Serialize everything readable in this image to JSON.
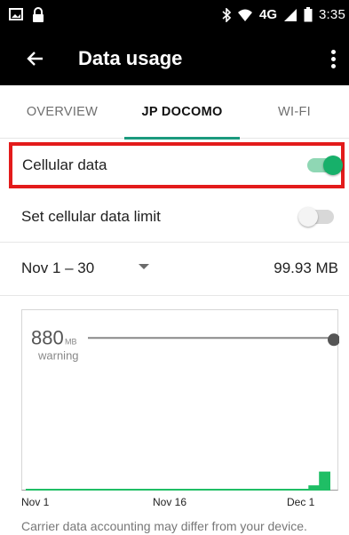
{
  "status_bar": {
    "time": "3:35",
    "network": "4G",
    "icons": [
      "image-icon",
      "lock-icon",
      "bluetooth-icon",
      "wifi-icon",
      "signal-icon",
      "battery-icon"
    ]
  },
  "app_bar": {
    "title": "Data usage",
    "back_icon": "arrow-back-icon",
    "menu_icon": "overflow-menu-icon"
  },
  "tabs": [
    {
      "label": "OVERVIEW",
      "selected": false
    },
    {
      "label": "JP DOCOMO",
      "selected": true
    },
    {
      "label": "WI-FI",
      "selected": false
    }
  ],
  "settings": {
    "cellular_data": {
      "label": "Cellular data",
      "enabled": true
    },
    "data_limit": {
      "label": "Set cellular data limit",
      "enabled": false
    }
  },
  "cycle": {
    "range": "Nov 1 – 30",
    "usage": "99.93 MB"
  },
  "warning": {
    "value": "880",
    "unit": "MB",
    "label": "warning"
  },
  "chart_data": {
    "type": "area",
    "x_labels": [
      "Nov 1",
      "Nov 16",
      "Dec 1"
    ],
    "warning_level_mb": 880,
    "y_max_mb": 1000,
    "usage_mb_by_day": [
      {
        "day": 1,
        "mb": 0
      },
      {
        "day": 28,
        "mb": 0
      },
      {
        "day": 28,
        "mb": 20
      },
      {
        "day": 29,
        "mb": 20
      },
      {
        "day": 29,
        "mb": 99.93
      },
      {
        "day": 30,
        "mb": 99.93
      }
    ],
    "colors": {
      "usage": "#1fbe65",
      "warning_line": "#888888",
      "handle": "#555555"
    }
  },
  "footnote": "Carrier data accounting may differ from your device."
}
